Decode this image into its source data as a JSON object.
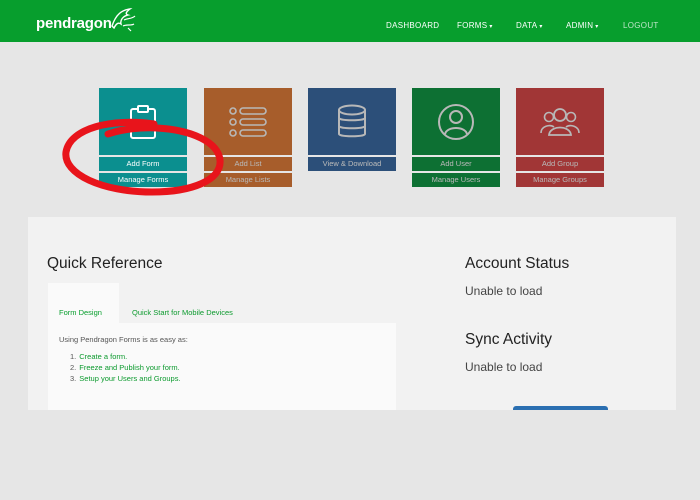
{
  "nav": {
    "logo": "pendragon",
    "items": [
      {
        "label": "DASHBOARD",
        "caret": false
      },
      {
        "label": "FORMS",
        "caret": true
      },
      {
        "label": "DATA",
        "caret": true
      },
      {
        "label": "ADMIN",
        "caret": true
      },
      {
        "label": "LOGOUT",
        "caret": false
      }
    ]
  },
  "tiles": [
    {
      "icon": "clipboard-icon",
      "color": "#0b8f8f",
      "buttons": [
        "Add Form",
        "Manage Forms"
      ]
    },
    {
      "icon": "list-icon",
      "color": "#e8823c",
      "buttons": [
        "Add List",
        "Manage Lists"
      ]
    },
    {
      "icon": "database-icon",
      "color": "#3d6ea8",
      "buttons": [
        "View & Download"
      ]
    },
    {
      "icon": "user-icon",
      "color": "#139b47",
      "buttons": [
        "Add User",
        "Manage Users"
      ]
    },
    {
      "icon": "group-icon",
      "color": "#e04b4b",
      "buttons": [
        "Add Group",
        "Manage Groups"
      ]
    }
  ],
  "quick_reference": {
    "title": "Quick Reference",
    "tabs": [
      "Form Design",
      "Quick Start for Mobile Devices"
    ],
    "intro": "Using Pendragon Forms is as easy as:",
    "steps": [
      "Create a form.",
      "Freeze and Publish your form.",
      "Setup your Users and Groups."
    ]
  },
  "account_status": {
    "title": "Account Status",
    "value": "Unable to load"
  },
  "sync_activity": {
    "title": "Sync Activity",
    "value": "Unable to load"
  }
}
